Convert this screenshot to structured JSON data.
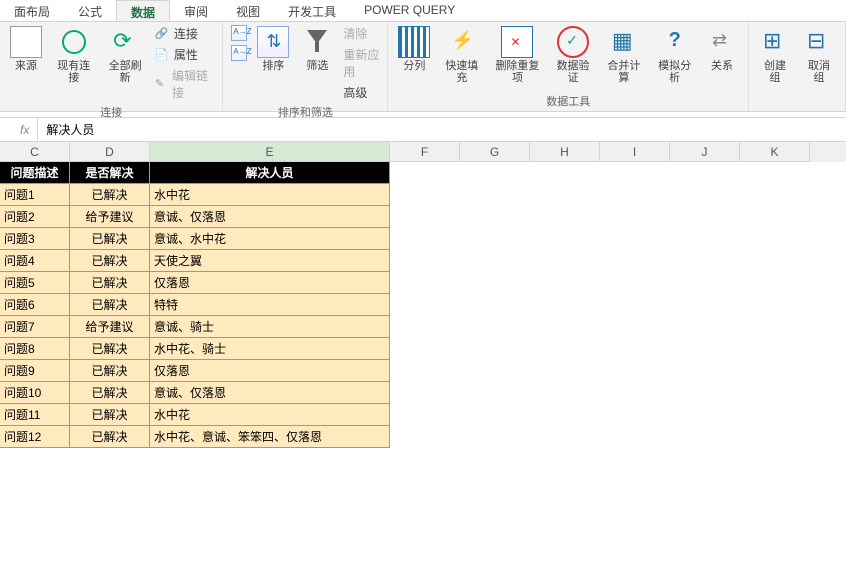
{
  "tabs": [
    "面布局",
    "公式",
    "数据",
    "审阅",
    "视图",
    "开发工具",
    "POWER QUERY"
  ],
  "active_tab_index": 2,
  "ribbon": {
    "grp_conn": {
      "source": "来源",
      "existing": "现有连接",
      "refresh": "全部刷新",
      "connections": "连接",
      "properties": "属性",
      "editlinks": "编辑链接",
      "label": "连接"
    },
    "grp_sort": {
      "sort": "排序",
      "filter": "筛选",
      "clear": "清除",
      "reapply": "重新应用",
      "advanced": "高级",
      "label": "排序和筛选"
    },
    "grp_data": {
      "textcol": "分列",
      "flash": "快速填充",
      "dup": "删除重复项",
      "valid": "数据验证",
      "consol": "合并计算",
      "whatif": "模拟分析",
      "rel": "关系",
      "label": "数据工具"
    },
    "grp_outline": {
      "group": "创建组",
      "ungroup": "取消组"
    }
  },
  "formula_bar": {
    "fx": "fx",
    "value": "解决人员"
  },
  "columns": [
    "C",
    "D",
    "E",
    "F",
    "G",
    "H",
    "I",
    "J",
    "K"
  ],
  "table": {
    "headers": {
      "c": "问题描述",
      "d": "是否解决",
      "e": "解决人员"
    },
    "rows": [
      {
        "c": "问题1",
        "d": "已解决",
        "e": "水中花"
      },
      {
        "c": "问题2",
        "d": "给予建议",
        "e": "意诚、仅落恩"
      },
      {
        "c": "问题3",
        "d": "已解决",
        "e": "意诚、水中花"
      },
      {
        "c": "问题4",
        "d": "已解决",
        "e": "天使之翼"
      },
      {
        "c": "问题5",
        "d": "已解决",
        "e": "仅落恩"
      },
      {
        "c": "问题6",
        "d": "已解决",
        "e": "特特"
      },
      {
        "c": "问题7",
        "d": "给予建议",
        "e": "意诚、骑士"
      },
      {
        "c": "问题8",
        "d": "已解决",
        "e": "水中花、骑士"
      },
      {
        "c": "问题9",
        "d": "已解决",
        "e": "仅落恩"
      },
      {
        "c": "问题10",
        "d": "已解决",
        "e": "意诚、仅落恩"
      },
      {
        "c": "问题11",
        "d": "已解决",
        "e": "水中花"
      },
      {
        "c": "问题12",
        "d": "已解决",
        "e": "水中花、意诚、笨笨四、仅落恩"
      }
    ]
  }
}
